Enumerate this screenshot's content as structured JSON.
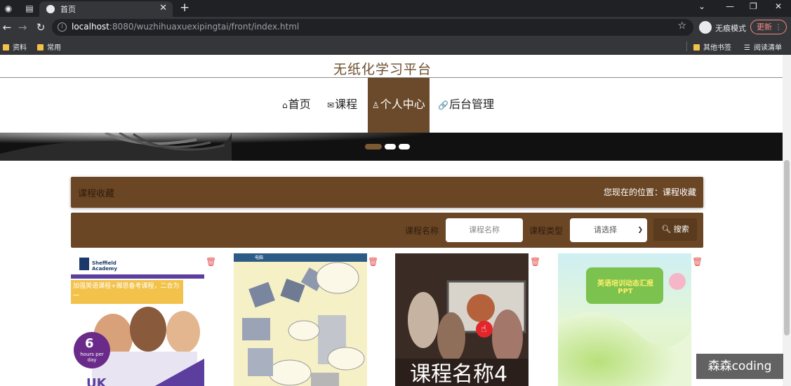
{
  "browser": {
    "tab_title": "首页",
    "url_host": "localhost",
    "url_rest": ":8080/wuzhihuaxuexipingtai/front/index.html",
    "incognito_label": "无痕模式",
    "update_label": "更新",
    "bookmarks": [
      "资料",
      "常用"
    ],
    "bookmarks_right": [
      "其他书签",
      "阅读清单"
    ]
  },
  "site": {
    "title": "无纸化学习平台",
    "nav": [
      {
        "icon": "⌂",
        "label": "首页"
      },
      {
        "icon": "✉",
        "label": "课程"
      },
      {
        "icon": "♙",
        "label": "个人中心"
      },
      {
        "icon": "🔗",
        "label": "后台管理"
      }
    ]
  },
  "crumb": {
    "section": "课程收藏",
    "location_label": "您现在的位置：课程收藏"
  },
  "search": {
    "name_label": "课程名称",
    "name_placeholder": "课程名称",
    "type_label": "课程类型",
    "type_selected": "请选择",
    "button_label": "搜索"
  },
  "cards": [
    {
      "poster_text": "Sheffield Academy",
      "headline": "加强英语课程+雅思备考课程，二合为一",
      "badge_num": "6",
      "badge_text": "hours per day",
      "country": "UK"
    },
    {
      "poster_text": "电脑"
    },
    {
      "caption": "课程名称4"
    },
    {
      "poster_text": "英语培训动态汇报PPT"
    }
  ],
  "watermark": "森森coding"
}
